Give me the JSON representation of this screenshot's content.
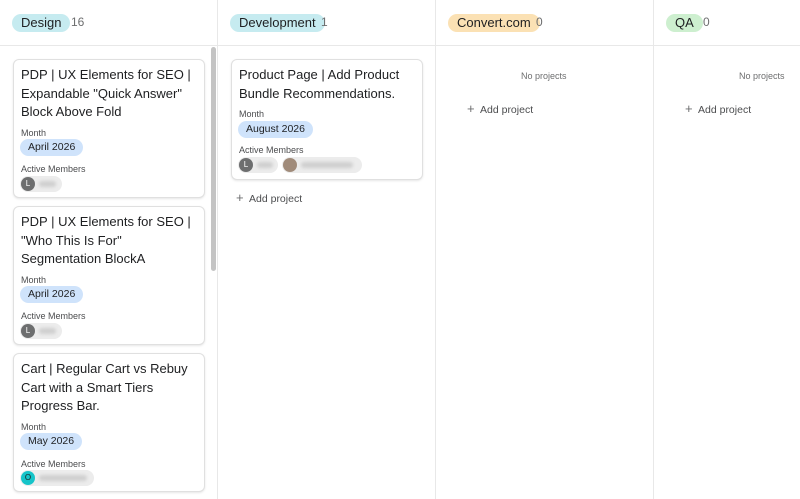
{
  "columns": [
    {
      "label": "Design",
      "count": "16",
      "color": "#c6ebf0",
      "cards": [
        {
          "title": "PDP | UX Elements for SEO | Expandable \"Quick Answer\" Block Above Fold",
          "month_label": "Month",
          "month": "April 2026",
          "members_label": "Active Members",
          "members": [
            {
              "initial": "L",
              "color": "#6d6e6f"
            }
          ]
        },
        {
          "title": "PDP | UX Elements for SEO | \"Who This Is For\" Segmentation BlockA",
          "month_label": "Month",
          "month": "April 2026",
          "members_label": "Active Members",
          "members": [
            {
              "initial": "L",
              "color": "#6d6e6f"
            }
          ]
        },
        {
          "title": "Cart | Regular Cart vs Rebuy Cart with a Smart Tiers Progress Bar.",
          "month_label": "Month",
          "month": "May 2026",
          "members_label": "Active Members",
          "members": [
            {
              "initial": "O",
              "color": "#16c4c9"
            }
          ]
        }
      ]
    },
    {
      "label": "Development",
      "count": "1",
      "color": "#c6ebf0",
      "cards": [
        {
          "title": "Product Page | Add Product Bundle Recommendations.",
          "month_label": "Month",
          "month": "August 2026",
          "members_label": "Active Members",
          "members": [
            {
              "initial": "L",
              "color": "#6d6e6f"
            },
            {
              "initial": "",
              "color": "#a08b7a"
            }
          ]
        }
      ],
      "add_label": "Add project"
    },
    {
      "label": "Convert.com",
      "count": "0",
      "color": "#fbe1b4",
      "empty_label": "No projects",
      "add_label": "Add project"
    },
    {
      "label": "QA",
      "count": "0",
      "color": "#cdefcf",
      "empty_label": "No projects",
      "add_label": "Add project"
    }
  ],
  "month_pill_color": "#cfe3fb"
}
